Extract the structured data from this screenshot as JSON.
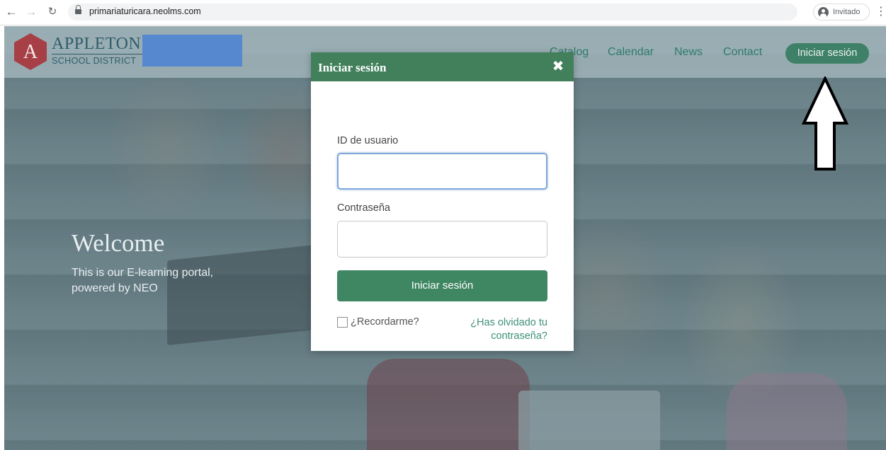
{
  "browser": {
    "url": "primariaturicara.neolms.com",
    "profile_label": "Invitado",
    "icons": [
      "back-arrow-icon",
      "forward-arrow-icon",
      "reload-icon",
      "lock-icon",
      "profile-icon",
      "menu-kebab-icon"
    ]
  },
  "header": {
    "logo_letter": "A",
    "logo_name": "APPLETON",
    "logo_subtitle": "SCHOOL DISTRICT",
    "nav": [
      "Catalog",
      "Calendar",
      "News",
      "Contact"
    ],
    "login_button": "Iniciar sesión",
    "colors": {
      "brand_red": "#a64046",
      "brand_green": "#3f8168",
      "redaction_blue": "#5688d0"
    }
  },
  "hero": {
    "title": "Welcome",
    "text": "This is our E-learning portal, powered by NEO"
  },
  "modal": {
    "title": "Iniciar sesión",
    "close_glyph": "✖",
    "username_label": "ID de usuario",
    "username_value": "",
    "password_label": "Contraseña",
    "password_value": "",
    "submit_label": "Iniciar sesión",
    "remember_label": "¿Recordarme?",
    "remember_checked": false,
    "forgot_link": "¿Has olvidado tu contraseña?",
    "colors": {
      "header": "#42805c",
      "button": "#3f8763",
      "link": "#3f8f7a"
    }
  }
}
